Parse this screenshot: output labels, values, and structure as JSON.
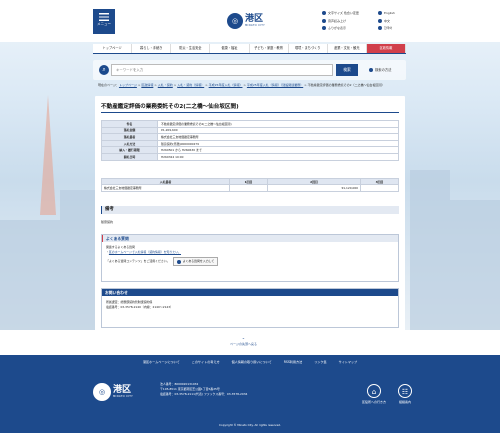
{
  "header": {
    "menu_label": "メニュー",
    "logo_jp": "港区",
    "logo_en": "MINATO CITY",
    "util_left": [
      "文字サイズ 色合い変更",
      "音声読み上げ",
      "ふりがな表示"
    ],
    "util_right": [
      "English",
      "中文",
      "한국어"
    ]
  },
  "gnav": [
    "トップページ",
    "暮らし・手続き",
    "防災・生活安全",
    "健康・福祉",
    "子ども・家庭・教育",
    "環境・まちづくり",
    "産業・文化・観光",
    "区政情報"
  ],
  "search": {
    "placeholder": "キーワードを入力",
    "button": "検索",
    "help": "検索の方法"
  },
  "breadcrumb": {
    "prefix": "現在のページ：",
    "items": [
      "トップページ",
      "区政情報",
      "入札・契約",
      "入札・契約（情報）",
      "平成25年度入札（情報）",
      "平成25年度入札（情報）（建設関連業務）",
      "不動産鑑定評価の業務委託その2（二之橋～仙台坂区間）"
    ],
    "sep": " > "
  },
  "page": {
    "title": "不動産鑑定評価の業務委託その2(二之橋～仙台坂区間)",
    "info": [
      {
        "label": "件名",
        "value": "不動産鑑定評価の業務委託その2(二之橋～仙台坂区間)"
      },
      {
        "label": "落札金額",
        "value": "¥1,209,600"
      },
      {
        "label": "落札業者",
        "value": "株式会社三友地価鑑定事務所"
      },
      {
        "label": "入札方法",
        "value": "随意契約(見積)0000000279"
      },
      {
        "label": "納入・履行期限",
        "value": "H260501 から H260630 まで"
      },
      {
        "label": "開札日時",
        "value": "H260324 10:00"
      }
    ],
    "bids": {
      "headers": [
        "入札業者",
        "1回目",
        "2回目",
        "3回目"
      ],
      "rows": [
        {
          "name": "株式会社三友地価鑑定事務所",
          "r1": "",
          "r2": "¥1,120,000",
          "r3": ""
        }
      ]
    },
    "remarks_heading": "備考",
    "remarks_text": "随意契約",
    "faq": {
      "heading": "よくある質問",
      "intro": "関連するよくある質問",
      "link": "区のホームページで入札情報（契約情報）を知りたい。",
      "search_label": "「よくある質問コンテンツ」をご活用ください。",
      "search_button": "よくある質問を入力して"
    },
    "contact": {
      "heading": "お問い合わせ",
      "dept": "所属課室：総務部契約管財課契約係",
      "tel": "電話番号：03-3578-2140（内線：2140～2143）"
    }
  },
  "pagetop": "ページの先頭へ戻る",
  "footer_nav": [
    "港区ホームページについて",
    "このサイトの考え方",
    "個人情報の取り扱いについて",
    "RSS利用方法",
    "リンク集",
    "サイトマップ"
  ],
  "footer": {
    "corp_no": "法人番号：8000020131032",
    "address": "〒105-8511 東京都港区芝公園1丁目5番25号",
    "tel": "電話番号：03-3578-2111(代表)  ファックス番号：03-3578-2034",
    "icon1": "区役所への行き方",
    "icon2": "組織案内",
    "copyright": "Copyright © Minato City. All rights reserved."
  }
}
